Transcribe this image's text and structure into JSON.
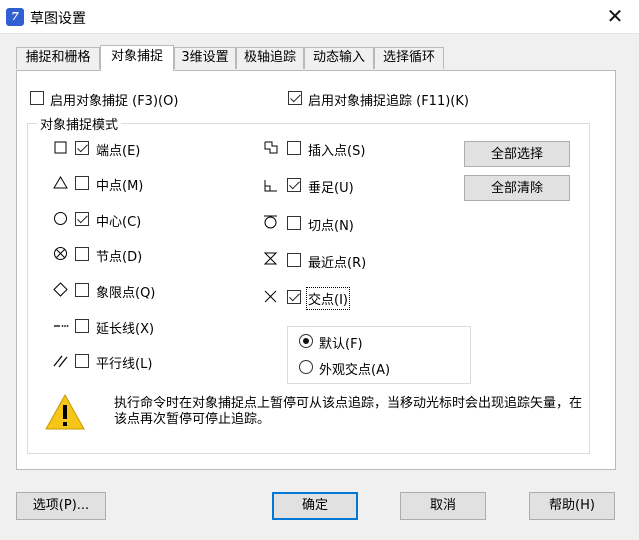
{
  "window": {
    "title": "草图设置",
    "close_glyph": "✕",
    "app_icon_glyph": "7"
  },
  "tabs": [
    {
      "label": "捕捉和栅格",
      "active": false
    },
    {
      "label": "对象捕捉",
      "active": true
    },
    {
      "label": "3维设置",
      "active": false
    },
    {
      "label": "极轴追踪",
      "active": false
    },
    {
      "label": "动态输入",
      "active": false
    },
    {
      "label": "选择循环",
      "active": false
    }
  ],
  "options": {
    "enable_snap": {
      "label": "启用对象捕捉 (F3)(O)",
      "checked": false
    },
    "enable_tracking": {
      "label": "启用对象捕捉追踪 (F11)(K)",
      "checked": true
    }
  },
  "group": {
    "title": "对象捕捉模式",
    "left_items": [
      {
        "label": "端点(E)",
        "checked": true,
        "icon": "square-endpoint-icon"
      },
      {
        "label": "中点(M)",
        "checked": false,
        "icon": "triangle-midpoint-icon"
      },
      {
        "label": "中心(C)",
        "checked": true,
        "icon": "circle-center-icon"
      },
      {
        "label": "节点(D)",
        "checked": false,
        "icon": "node-icon"
      },
      {
        "label": "象限点(Q)",
        "checked": false,
        "icon": "diamond-quadrant-icon"
      },
      {
        "label": "延长线(X)",
        "checked": false,
        "icon": "extension-icon"
      },
      {
        "label": "平行线(L)",
        "checked": false,
        "icon": "parallel-icon"
      }
    ],
    "right_items": [
      {
        "label": "插入点(S)",
        "checked": false,
        "icon": "insertion-icon"
      },
      {
        "label": "垂足(U)",
        "checked": true,
        "icon": "perpendicular-icon"
      },
      {
        "label": "切点(N)",
        "checked": false,
        "icon": "tangent-icon"
      },
      {
        "label": "最近点(R)",
        "checked": false,
        "icon": "nearest-icon"
      },
      {
        "label": "交点(I)",
        "checked": true,
        "icon": "intersection-icon"
      }
    ],
    "select_all": "全部选择",
    "clear_all": "全部清除",
    "radios": [
      {
        "label": "默认(F)",
        "selected": true
      },
      {
        "label": "外观交点(A)",
        "selected": false
      }
    ],
    "info": "执行命令时在对象捕捉点上暂停可从该点追踪，当移动光标时会出现追踪矢量，在该点再次暂停可停止追踪。",
    "info_icon": "warning-icon"
  },
  "footer": {
    "options": "选项(P)...",
    "ok": "确定",
    "cancel": "取消",
    "help": "帮助(H)"
  },
  "colors": {
    "accent": "#0078d7",
    "warning": "#f5c518"
  }
}
